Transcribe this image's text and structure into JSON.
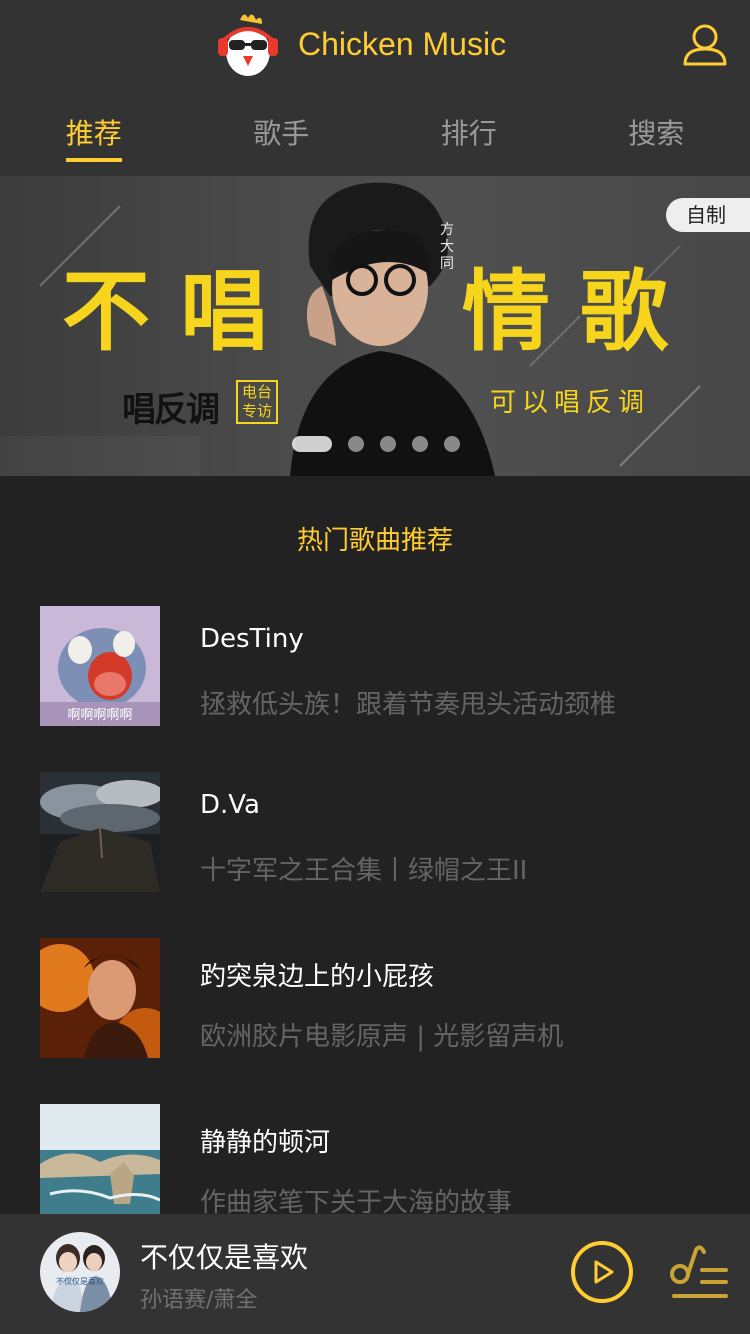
{
  "header": {
    "title": "Chicken Music",
    "logo_icon": "chicken-logo-icon",
    "user_icon": "user-icon"
  },
  "tabs": [
    {
      "label": "推荐",
      "active": true
    },
    {
      "label": "歌手",
      "active": false
    },
    {
      "label": "排行",
      "active": false
    },
    {
      "label": "搜索",
      "active": false
    }
  ],
  "banner": {
    "headline_left": "不唱",
    "headline_right": "情歌",
    "artist_name": "方大同",
    "subtitle": "可以唱反调",
    "show_logo": "唱反调",
    "radio_label": "电台专访",
    "tag": "自制",
    "slide_count": 5,
    "active_slide": 1
  },
  "hot": {
    "title": "热门歌曲推荐",
    "songs": [
      {
        "name": "DesTiny",
        "desc": "拯救低头族！跟着节奏甩头活动颈椎",
        "cover_caption": "啊啊啊啊啊"
      },
      {
        "name": "D.Va",
        "desc": "十字军之王合集丨绿帽之王II"
      },
      {
        "name": "趵突泉边上的小屁孩",
        "desc": "欧洲胶片电影原声 | 光影留声机"
      },
      {
        "name": "静静的顿河",
        "desc": "作曲家笔下关于大海的故事"
      }
    ]
  },
  "player": {
    "title": "不仅仅是喜欢",
    "artist": "孙语赛/萧全",
    "cover_caption": "不仅仅是喜欢",
    "play_icon": "play-icon",
    "playlist_icon": "playlist-icon"
  },
  "colors": {
    "accent": "#ffcd32",
    "background": "#222222",
    "bar": "#333333",
    "banner_yellow": "#f7d51d"
  }
}
